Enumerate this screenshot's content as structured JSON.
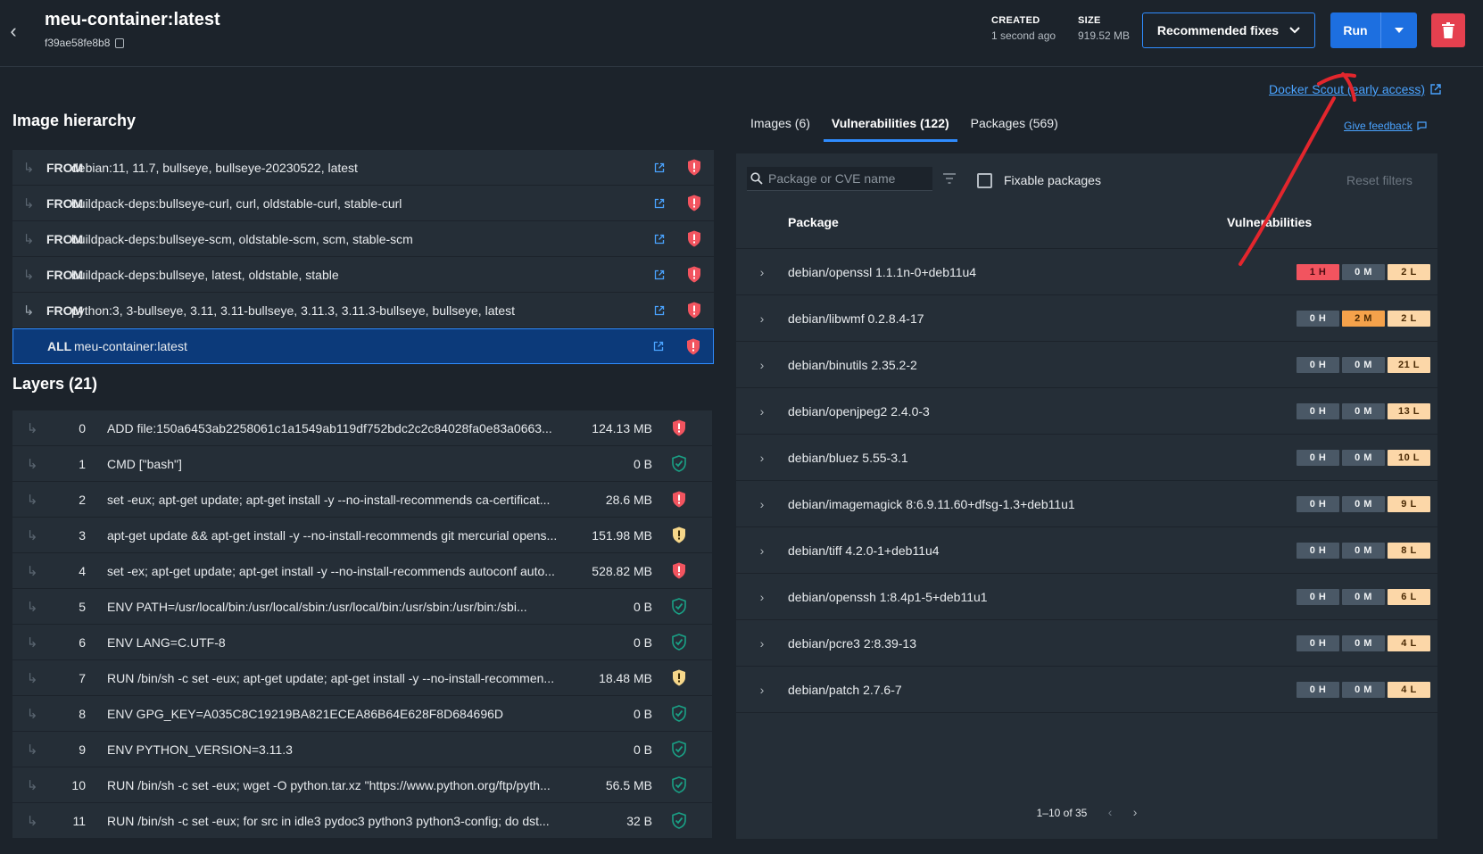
{
  "header": {
    "title": "meu-container:latest",
    "digest": "f39ae58fe8b8",
    "created_label": "CREATED",
    "created_value": "1 second ago",
    "size_label": "SIZE",
    "size_value": "919.52 MB",
    "recommended_label": "Recommended fixes",
    "run_label": "Run"
  },
  "links": {
    "scout": "Docker Scout (early access)",
    "feedback": "Give feedback"
  },
  "hierarchy": {
    "title": "Image hierarchy",
    "rows": [
      {
        "kw": "FROM",
        "name": "debian:11, 11.7, bullseye, bullseye-20230522, latest"
      },
      {
        "kw": "FROM",
        "name": "buildpack-deps:bullseye-curl, curl, oldstable-curl, stable-curl"
      },
      {
        "kw": "FROM",
        "name": "buildpack-deps:bullseye-scm, oldstable-scm, scm, stable-scm"
      },
      {
        "kw": "FROM",
        "name": "buildpack-deps:bullseye, latest, oldstable, stable"
      },
      {
        "kw": "FROM",
        "name": "python:3, 3-bullseye, 3.11, 3.11-bullseye, 3.11.3, 3.11.3-bullseye, bullseye, latest"
      },
      {
        "kw": "ALL",
        "name": "meu-container:latest"
      }
    ]
  },
  "layers": {
    "title": "Layers (21)",
    "rows": [
      {
        "idx": "0",
        "cmd": "ADD file:150a6453ab2258061c1a1549ab119df752bdc2c2c84028fa0e83a0663...",
        "size": "124.13 MB",
        "status": "red"
      },
      {
        "idx": "1",
        "cmd": "CMD [\"bash\"]",
        "size": "0 B",
        "status": "green"
      },
      {
        "idx": "2",
        "cmd": "set -eux; apt-get update; apt-get install -y --no-install-recommends ca-certificat...",
        "size": "28.6 MB",
        "status": "red"
      },
      {
        "idx": "3",
        "cmd": "apt-get update && apt-get install -y --no-install-recommends git mercurial opens...",
        "size": "151.98 MB",
        "status": "yellow"
      },
      {
        "idx": "4",
        "cmd": "set -ex; apt-get update; apt-get install -y --no-install-recommends autoconf auto...",
        "size": "528.82 MB",
        "status": "red"
      },
      {
        "idx": "5",
        "cmd": "ENV PATH=/usr/local/bin:/usr/local/sbin:/usr/local/bin:/usr/sbin:/usr/bin:/sbi...",
        "size": "0 B",
        "status": "green"
      },
      {
        "idx": "6",
        "cmd": "ENV LANG=C.UTF-8",
        "size": "0 B",
        "status": "green"
      },
      {
        "idx": "7",
        "cmd": "RUN /bin/sh -c set -eux; apt-get update; apt-get install -y --no-install-recommen...",
        "size": "18.48 MB",
        "status": "yellow"
      },
      {
        "idx": "8",
        "cmd": "ENV GPG_KEY=A035C8C19219BA821ECEA86B64E628F8D684696D",
        "size": "0 B",
        "status": "green"
      },
      {
        "idx": "9",
        "cmd": "ENV PYTHON_VERSION=3.11.3",
        "size": "0 B",
        "status": "green"
      },
      {
        "idx": "10",
        "cmd": "RUN /bin/sh -c set -eux; wget -O python.tar.xz \"https://www.python.org/ftp/pyth...",
        "size": "56.5 MB",
        "status": "green"
      },
      {
        "idx": "11",
        "cmd": "RUN /bin/sh -c set -eux; for src in idle3 pydoc3 python3 python3-config; do dst...",
        "size": "32 B",
        "status": "green"
      }
    ]
  },
  "tabs": [
    {
      "label": "Images (6)",
      "active": false
    },
    {
      "label": "Vulnerabilities (122)",
      "active": true
    },
    {
      "label": "Packages (569)",
      "active": false
    }
  ],
  "vuln": {
    "search_placeholder": "Package or CVE name",
    "fixable_label": "Fixable packages",
    "reset_label": "Reset filters",
    "col_package": "Package",
    "col_vulns": "Vulnerabilities",
    "pager": "1–10 of 35",
    "rows": [
      {
        "pkg": "debian/openssl 1.1.1n-0+deb11u4",
        "h": "1 H",
        "m": "0 M",
        "l": "2 L"
      },
      {
        "pkg": "debian/libwmf 0.2.8.4-17",
        "h": "0 H",
        "m": "2 M",
        "l": "2 L"
      },
      {
        "pkg": "debian/binutils 2.35.2-2",
        "h": "0 H",
        "m": "0 M",
        "l": "21 L"
      },
      {
        "pkg": "debian/openjpeg2 2.4.0-3",
        "h": "0 H",
        "m": "0 M",
        "l": "13 L"
      },
      {
        "pkg": "debian/bluez 5.55-3.1",
        "h": "0 H",
        "m": "0 M",
        "l": "10 L"
      },
      {
        "pkg": "debian/imagemagick 8:6.9.11.60+dfsg-1.3+deb11u1",
        "h": "0 H",
        "m": "0 M",
        "l": "9 L"
      },
      {
        "pkg": "debian/tiff 4.2.0-1+deb11u4",
        "h": "0 H",
        "m": "0 M",
        "l": "8 L"
      },
      {
        "pkg": "debian/openssh 1:8.4p1-5+deb11u1",
        "h": "0 H",
        "m": "0 M",
        "l": "6 L"
      },
      {
        "pkg": "debian/pcre3 2:8.39-13",
        "h": "0 H",
        "m": "0 M",
        "l": "4 L"
      },
      {
        "pkg": "debian/patch 2.7.6-7",
        "h": "0 H",
        "m": "0 M",
        "l": "4 L"
      }
    ]
  },
  "colors": {
    "accent": "#2f8cff",
    "critical": "#f2545f",
    "medium": "#f5a24b",
    "low": "#fcd7a8",
    "safe": "#1aa085",
    "warn": "#f6d78a"
  }
}
